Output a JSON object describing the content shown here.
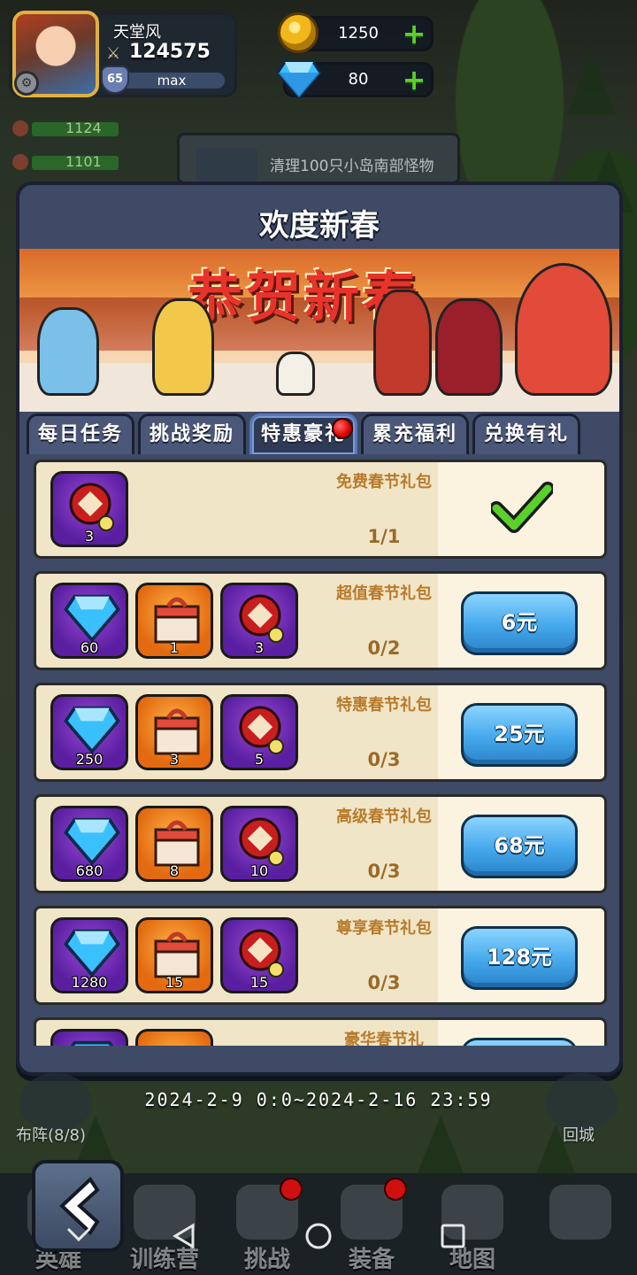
{
  "player": {
    "name": "天堂风",
    "power": "124575",
    "level": "65",
    "vip_label": "max"
  },
  "currencies": {
    "gold": "1250",
    "gems": "80"
  },
  "hp_rows": [
    "1124",
    "1101"
  ],
  "quest_banner": "清理100只小岛南部怪物",
  "panel": {
    "title": "欢度新春",
    "banner_text": "恭贺新春"
  },
  "tabs": [
    {
      "label": "每日任务",
      "active": false,
      "red_dot": false
    },
    {
      "label": "挑战奖励",
      "active": false,
      "red_dot": false
    },
    {
      "label": "特惠豪礼",
      "active": true,
      "red_dot": true
    },
    {
      "label": "累充福利",
      "active": false,
      "red_dot": false
    },
    {
      "label": "兑换有礼",
      "active": false,
      "red_dot": false
    }
  ],
  "packages": [
    {
      "name": "免费春节礼包",
      "progress": "1/1",
      "price": "",
      "claimed": true,
      "items": [
        {
          "type": "fu-icon",
          "qty": "3"
        }
      ]
    },
    {
      "name": "超值春节礼包",
      "progress": "0/2",
      "price": "6元",
      "claimed": false,
      "items": [
        {
          "type": "gem-icon",
          "qty": "60"
        },
        {
          "type": "gift-box-icon",
          "qty": "1"
        },
        {
          "type": "fu-icon",
          "qty": "3"
        }
      ]
    },
    {
      "name": "特惠春节礼包",
      "progress": "0/3",
      "price": "25元",
      "claimed": false,
      "items": [
        {
          "type": "gem-icon",
          "qty": "250"
        },
        {
          "type": "gift-box-icon",
          "qty": "3"
        },
        {
          "type": "fu-icon",
          "qty": "5"
        }
      ]
    },
    {
      "name": "高级春节礼包",
      "progress": "0/3",
      "price": "68元",
      "claimed": false,
      "items": [
        {
          "type": "gem-icon",
          "qty": "680"
        },
        {
          "type": "gift-box-icon",
          "qty": "8"
        },
        {
          "type": "fu-icon",
          "qty": "10"
        }
      ]
    },
    {
      "name": "尊享春节礼包",
      "progress": "0/3",
      "price": "128元",
      "claimed": false,
      "items": [
        {
          "type": "gem-icon",
          "qty": "1280"
        },
        {
          "type": "gift-box-icon",
          "qty": "15"
        },
        {
          "type": "fu-icon",
          "qty": "15"
        }
      ]
    },
    {
      "name": "豪华春节礼",
      "progress": "",
      "price": "",
      "claimed": false,
      "items": [
        {
          "type": "gem-icon",
          "qty": ""
        },
        {
          "type": "gift-box-icon",
          "qty": ""
        }
      ]
    }
  ],
  "event_time": "2024-2-9 0:0~2024-2-16 23:59",
  "side": {
    "formation_label": "布阵(8/8)",
    "return_city_label": "回城"
  },
  "bottom_nav": [
    {
      "label": "英雄",
      "badge": false
    },
    {
      "label": "训练营",
      "badge": false
    },
    {
      "label": "挑战",
      "badge": true
    },
    {
      "label": "装备",
      "badge": true
    },
    {
      "label": "地图",
      "badge": false
    },
    {
      "label": "",
      "badge": false
    }
  ],
  "colors": {
    "panel_bg": "#3e4a66",
    "row_bg": "#f1e5c8",
    "buy_button": "#45a8ea",
    "package_name": "#b87a2a",
    "plus_green": "#5bd02a"
  }
}
